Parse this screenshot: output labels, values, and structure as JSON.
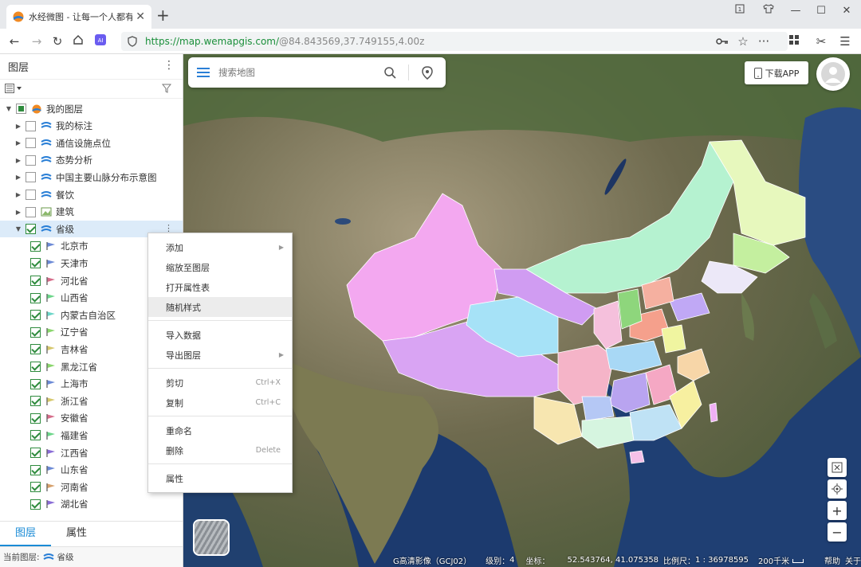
{
  "browser": {
    "tab_title": "水经微图 - 让每一个人都有自",
    "url_host": "https://map.wemapgis.com/",
    "url_rest": "@84.843569,37.749155,4.00z"
  },
  "panel": {
    "title": "图层",
    "tree": [
      {
        "label": "我的图层",
        "level": 0,
        "expanded": true,
        "check": "partial",
        "icon": "globe-icon"
      },
      {
        "label": "我的标注",
        "level": 1,
        "expanded": false,
        "check": "none",
        "icon": "layer-icon"
      },
      {
        "label": "通信设施点位",
        "level": 1,
        "expanded": false,
        "check": "none",
        "icon": "layer-icon"
      },
      {
        "label": "态势分析",
        "level": 1,
        "expanded": false,
        "check": "none",
        "icon": "layer-icon"
      },
      {
        "label": "中国主要山脉分布示意图",
        "level": 1,
        "expanded": false,
        "check": "none",
        "icon": "layer-icon"
      },
      {
        "label": "餐饮",
        "level": 1,
        "expanded": false,
        "check": "none",
        "icon": "layer-icon"
      },
      {
        "label": "建筑",
        "level": 1,
        "expanded": false,
        "check": "none",
        "icon": "image-layer-icon"
      },
      {
        "label": "省级",
        "level": 1,
        "expanded": true,
        "check": "checked",
        "icon": "layer-icon",
        "selected": true
      },
      {
        "label": "北京市",
        "level": 2,
        "check": "checked",
        "icon": "flag-icon",
        "color": "#6c8ad6"
      },
      {
        "label": "天津市",
        "level": 2,
        "check": "checked",
        "icon": "flag-icon",
        "color": "#6c8ad6"
      },
      {
        "label": "河北省",
        "level": 2,
        "check": "checked",
        "icon": "flag-icon",
        "color": "#d66c8a"
      },
      {
        "label": "山西省",
        "level": 2,
        "check": "checked",
        "icon": "flag-icon",
        "color": "#6cd68a"
      },
      {
        "label": "内蒙古自治区",
        "level": 2,
        "check": "checked",
        "icon": "flag-icon",
        "color": "#6cd6c8"
      },
      {
        "label": "辽宁省",
        "level": 2,
        "check": "checked",
        "icon": "flag-icon",
        "color": "#8ad66c"
      },
      {
        "label": "吉林省",
        "level": 2,
        "check": "checked",
        "icon": "flag-icon",
        "color": "#d6c86c"
      },
      {
        "label": "黑龙江省",
        "level": 2,
        "check": "checked",
        "icon": "flag-icon",
        "color": "#8ad66c"
      },
      {
        "label": "上海市",
        "level": 2,
        "check": "checked",
        "icon": "flag-icon",
        "color": "#6c8ad6"
      },
      {
        "label": "浙江省",
        "level": 2,
        "check": "checked",
        "icon": "flag-icon",
        "color": "#d6c86c"
      },
      {
        "label": "安徽省",
        "level": 2,
        "check": "checked",
        "icon": "flag-icon",
        "color": "#d66c8a"
      },
      {
        "label": "福建省",
        "level": 2,
        "check": "checked",
        "icon": "flag-icon",
        "color": "#6cd68a"
      },
      {
        "label": "江西省",
        "level": 2,
        "check": "checked",
        "icon": "flag-icon",
        "color": "#8a6cd6"
      },
      {
        "label": "山东省",
        "level": 2,
        "check": "checked",
        "icon": "flag-icon",
        "color": "#6c8ad6"
      },
      {
        "label": "河南省",
        "level": 2,
        "check": "checked",
        "icon": "flag-icon",
        "color": "#d6a06c"
      },
      {
        "label": "湖北省",
        "level": 2,
        "check": "checked",
        "icon": "flag-icon",
        "color": "#8a6cd6"
      }
    ],
    "tabs": {
      "layers": "图层",
      "props": "属性"
    },
    "current_layer_label": "当前图层:",
    "current_layer_value": "省级"
  },
  "context_menu": {
    "items": [
      {
        "label": "添加",
        "submenu": true
      },
      {
        "label": "缩放至图层"
      },
      {
        "label": "打开属性表"
      },
      {
        "label": "随机样式",
        "hover": true
      },
      {
        "separator": true
      },
      {
        "label": "导入数据"
      },
      {
        "label": "导出图层",
        "submenu": true
      },
      {
        "separator": true
      },
      {
        "label": "剪切",
        "shortcut": "Ctrl+X"
      },
      {
        "label": "复制",
        "shortcut": "Ctrl+C"
      },
      {
        "separator": true
      },
      {
        "label": "重命名"
      },
      {
        "label": "删除",
        "shortcut": "Delete"
      },
      {
        "separator": true
      },
      {
        "label": "属性"
      }
    ]
  },
  "map": {
    "search_placeholder": "搜索地图",
    "download_app": "下载APP",
    "status": {
      "basemap": "G高清影像（GCJ02）",
      "level_label": "级别：",
      "level": "4",
      "coord_label": "坐标：",
      "coord": "52.543764, 41.075358",
      "scale_label": "比例尺：",
      "scale": "1 : 36978595",
      "distance": "200千米",
      "help": "帮助",
      "close": "关于"
    }
  },
  "colors": {
    "accent": "#1a8bd6",
    "url_green": "#1a8f3a",
    "check_green": "#2e8b3d"
  }
}
